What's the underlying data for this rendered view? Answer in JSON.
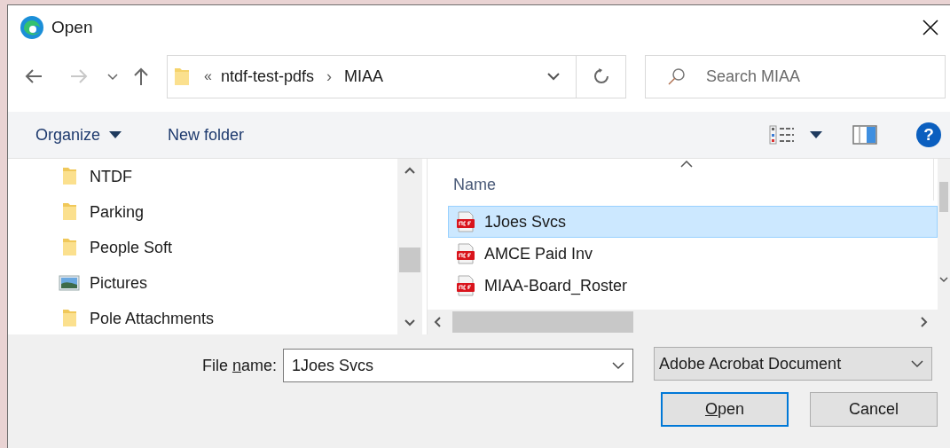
{
  "window": {
    "title": "Open"
  },
  "nav_buttons": [
    {
      "kind": "back",
      "disabled": false
    },
    {
      "kind": "forward",
      "disabled": true
    },
    {
      "kind": "recent",
      "disabled": false
    },
    {
      "kind": "up",
      "disabled": false
    }
  ],
  "address": {
    "overflow": "«",
    "separator": "›",
    "path": [
      "ntdf-test-pdfs",
      "MIAA"
    ]
  },
  "search": {
    "placeholder": "Search MIAA"
  },
  "toolbar": {
    "organize": "Organize",
    "new_folder": "New folder",
    "help": "?"
  },
  "nav_pane": {
    "items": [
      {
        "label": "NTDF",
        "kind": "folder"
      },
      {
        "label": "Parking",
        "kind": "folder"
      },
      {
        "label": "People Soft",
        "kind": "folder"
      },
      {
        "label": "Pictures",
        "kind": "pictures"
      },
      {
        "label": "Pole Attachments",
        "kind": "folder"
      }
    ]
  },
  "file_list": {
    "columns": [
      "Name"
    ],
    "rows": [
      {
        "name": "1Joes Svcs",
        "selected": true
      },
      {
        "name": "AMCE Paid Inv",
        "selected": false
      },
      {
        "name": "MIAA-Board_Roster",
        "selected": false
      }
    ]
  },
  "file_name": {
    "label": [
      {
        "text": "File ",
        "underlined": false
      },
      {
        "text": "n",
        "underlined": true
      },
      {
        "text": "ame:",
        "underlined": false
      }
    ],
    "value": "1Joes Svcs"
  },
  "file_type": {
    "value": "Adobe Acrobat Document"
  },
  "buttons": [
    {
      "label": [
        {
          "text": "O",
          "underlined": true
        },
        {
          "text": "pen",
          "underlined": false
        }
      ],
      "default": true
    },
    {
      "label": [
        {
          "text": "Cancel",
          "underlined": false
        }
      ],
      "default": false
    }
  ]
}
